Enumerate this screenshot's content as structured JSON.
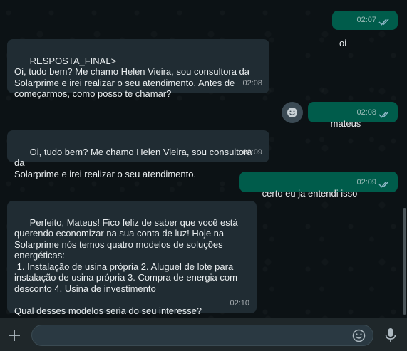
{
  "messages": [
    {
      "direction": "out",
      "text": "oi",
      "time": "02:07"
    },
    {
      "direction": "in",
      "text": "RESPOSTA_FINAL>\nOi, tudo bem? Me chamo Helen Vieira, sou consultora da\nSolarprime e irei realizar o seu atendimento. Antes de\ncomeçarmos, como posso te chamar?",
      "time": "02:08"
    },
    {
      "direction": "out",
      "text": "mateus",
      "time": "02:08"
    },
    {
      "direction": "in",
      "text": "Oi, tudo bem? Me chamo Helen Vieira, sou consultora da\nSolarprime e irei realizar o seu atendimento.",
      "time": "02:09"
    },
    {
      "direction": "out",
      "text": "certo eu ja entendi isso",
      "time": "02:09"
    },
    {
      "direction": "in",
      "text": "Perfeito, Mateus! Fico feliz de saber que você está\nquerendo economizar na sua conta de luz! Hoje na\nSolarprime nós temos quatro modelos de soluções\nenergéticas:\n 1. Instalação de usina própria 2. Aluguel de lote para\ninstalação de usina própria 3. Compra de energia com\ndesconto 4. Usina de investimento\n\nQual desses modelos seria do seu interesse?",
      "time": "02:10"
    }
  ],
  "composer": {
    "placeholder": ""
  },
  "icons": {
    "attach": "plus-icon",
    "emoji": "emoji-icon",
    "voice": "mic-icon",
    "read_receipt": "double-check-icon",
    "avatar": "avatar-emoji-icon"
  },
  "colors": {
    "incoming_bubble": "#202c33",
    "outgoing_bubble": "#005c4b",
    "background": "#0c1215",
    "read_ticks": "#8fb8c8"
  }
}
